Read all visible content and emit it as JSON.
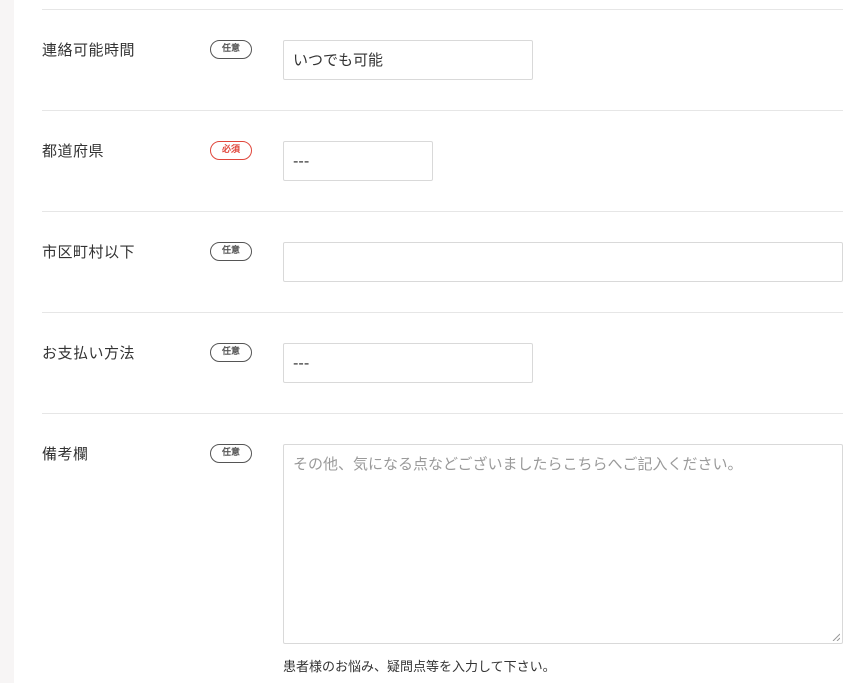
{
  "form": {
    "rows": [
      {
        "label": "連絡可能時間",
        "badge": "任意",
        "value": "いつでも可能"
      },
      {
        "label": "都道府県",
        "badge": "必須",
        "value": "---"
      },
      {
        "label": "市区町村以下",
        "badge": "任意",
        "value": ""
      },
      {
        "label": "お支払い方法",
        "badge": "任意",
        "value": "---"
      },
      {
        "label": "備考欄",
        "badge": "任意",
        "placeholder": "その他、気になる点などございましたらこちらへご記入ください。",
        "help": "患者様のお悩み、疑問点等を入力して下さい。"
      }
    ]
  },
  "colors": {
    "required": "#e0473c",
    "optional": "#555555",
    "border": "#d9d9d9",
    "divider": "#e6e6e6"
  }
}
